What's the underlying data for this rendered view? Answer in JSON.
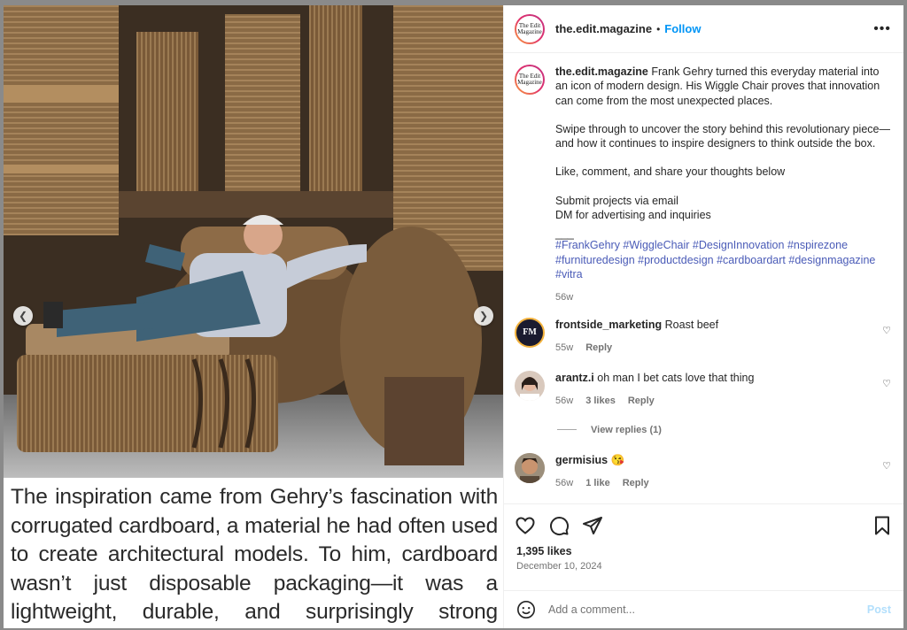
{
  "post": {
    "username": "the.edit.magazine",
    "follow_label": "Follow",
    "dot": "•",
    "more_label": "•••",
    "avatar_text": "The Edit Magazine",
    "caption_paragraphs": [
      "Frank Gehry turned this everyday material into an icon of modern design. His Wiggle Chair proves that innovation can come from the most unexpected places.",
      "Swipe through to uncover the story behind this revolutionary piece—and how it continues to inspire designers to think outside the box.",
      "Like, comment, and share your thoughts below",
      "Submit projects via email",
      "DM for advertising and inquiries",
      "___"
    ],
    "hashtags": "#FrankGehry #WiggleChair #DesignInnovation #nspirezone #furnituredesign #productdesign #cardboardart #designmagazine #vitra",
    "caption_time": "56w",
    "likes": "1,395 likes",
    "date": "December 10, 2024"
  },
  "media": {
    "overlay_text": "The inspiration came from Gehry’s fascination with corrugated cardboard, a material he had often used to create architectural models. To him, cardboard wasn’t just disposable packaging—it was a lightweight, durable, and surprisingly strong medium with untapped potential.",
    "prev_icon": "chevron-left-icon",
    "next_icon": "chevron-right-icon"
  },
  "comments": [
    {
      "user": "frontside_marketing",
      "text": "Roast beef",
      "time": "55w",
      "likes": "",
      "reply": "Reply",
      "avatar_text": "FM"
    },
    {
      "user": "arantz.i",
      "text": "oh man I bet cats love that thing",
      "time": "56w",
      "likes": "3 likes",
      "reply": "Reply",
      "view_replies": "View replies (1)"
    },
    {
      "user": "germisius",
      "text": "😘",
      "time": "56w",
      "likes": "1 like",
      "reply": "Reply"
    }
  ],
  "composer": {
    "placeholder": "Add a comment...",
    "post_label": "Post"
  },
  "icons": {
    "heart": "heart-icon",
    "comment": "comment-icon",
    "share": "share-icon",
    "save": "bookmark-icon",
    "emoji": "emoji-icon"
  },
  "colors": {
    "link": "#0095f6",
    "hashtag": "#4a5bb7",
    "muted": "#737373"
  }
}
